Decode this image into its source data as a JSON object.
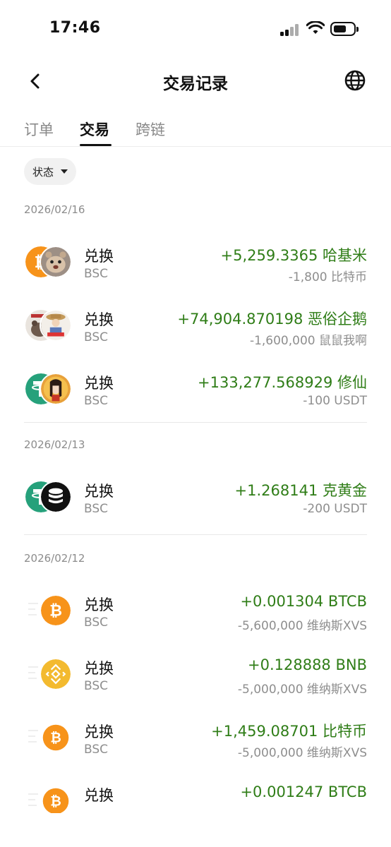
{
  "status_bar": {
    "time": "17:46"
  },
  "header": {
    "title": "交易记录"
  },
  "tabs": [
    {
      "label": "订单"
    },
    {
      "label": "交易"
    },
    {
      "label": "跨链"
    }
  ],
  "filter": {
    "label": "状态"
  },
  "groups": [
    {
      "date": "2026/02/16",
      "rows": [
        {
          "type": "兑换",
          "chain": "BSC",
          "received": "+5,259.3365 哈基米",
          "sent": "-1,800 比特币",
          "icon_from": "bitcoin-orange-icon",
          "icon_to": "hamster-avatar-icon"
        },
        {
          "type": "兑换",
          "chain": "BSC",
          "received": "+74,904.870198 恶俗企鹅",
          "sent": "-1,600,000 鼠鼠我啊",
          "icon_from": "mouse-meme-avatar-icon",
          "icon_to": "penguin-meme-avatar-icon"
        },
        {
          "type": "兑换",
          "chain": "BSC",
          "received": "+133,277.568929 修仙",
          "sent": "-100 USDT",
          "icon_from": "usdt-icon",
          "icon_to": "xiuxian-avatar-icon"
        }
      ]
    },
    {
      "date": "2026/02/13",
      "rows": [
        {
          "type": "兑换",
          "chain": "BSC",
          "received": "+1.268141 克黄金",
          "sent": "-200 USDT",
          "icon_from": "usdt-icon",
          "icon_to": "gold-stack-icon"
        }
      ]
    },
    {
      "date": "2026/02/12",
      "rows": [
        {
          "type": "兑换",
          "chain": "BSC",
          "received": "+0.001304 BTCB",
          "sent": "-5,600,000 维纳斯XVS",
          "icon_from": "xvs-placeholder-icon",
          "icon_to": "btcb-icon"
        },
        {
          "type": "兑换",
          "chain": "BSC",
          "received": "+0.128888 BNB",
          "sent": "-5,000,000 维纳斯XVS",
          "icon_from": "xvs-placeholder-icon",
          "icon_to": "bnb-icon"
        },
        {
          "type": "兑换",
          "chain": "BSC",
          "received": "+1,459.08701 比特币",
          "sent": "-5,000,000 维纳斯XVS",
          "icon_from": "xvs-placeholder-icon",
          "icon_to": "bitcoin-orange-icon"
        },
        {
          "type": "兑换",
          "chain": "",
          "received": "+0.001247 BTCB",
          "sent": "",
          "icon_from": "xvs-placeholder-icon",
          "icon_to": "btcb-icon"
        }
      ]
    }
  ],
  "colors": {
    "positive": "#2f7d17",
    "muted": "#8e8e8e",
    "bitcoin": "#f7931a",
    "usdt": "#26a17b",
    "bnb": "#f3ba2f"
  }
}
